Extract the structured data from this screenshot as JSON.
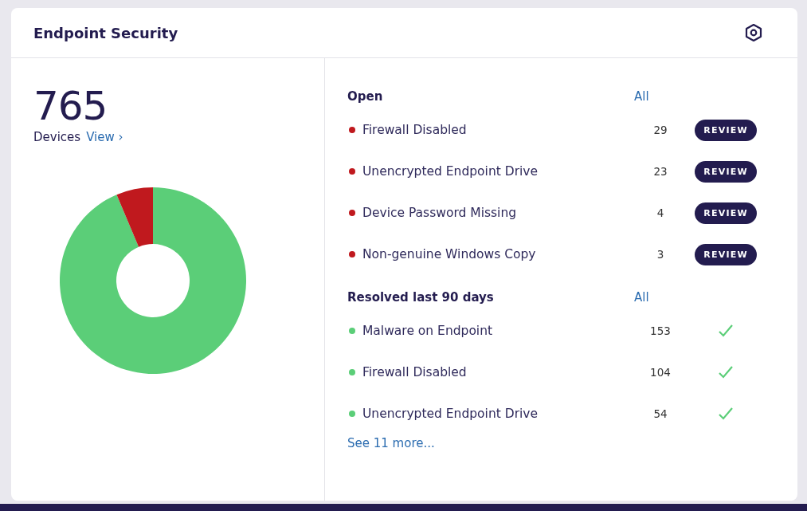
{
  "card": {
    "title": "Endpoint Security"
  },
  "summary": {
    "count": "765",
    "label": "Devices",
    "link": "View ›"
  },
  "sections": [
    {
      "kind": "open",
      "title": "Open",
      "link": "All",
      "items": [
        {
          "label": "Firewall Disabled",
          "count": "29",
          "color": "#c0191e",
          "action": "REVIEW"
        },
        {
          "label": "Unencrypted Endpoint Drive",
          "count": "23",
          "color": "#c0191e",
          "action": "REVIEW"
        },
        {
          "label": "Device Password Missing",
          "count": "4",
          "color": "#c0191e",
          "action": "REVIEW"
        },
        {
          "label": "Non-genuine Windows Copy",
          "count": "3",
          "color": "#c0191e",
          "action": "REVIEW"
        }
      ]
    },
    {
      "kind": "resolved",
      "title": "Resolved last 90 days",
      "link": "All",
      "items": [
        {
          "label": "Malware on Endpoint",
          "count": "153",
          "color": "#5bce78"
        },
        {
          "label": "Firewall Disabled",
          "count": "104",
          "color": "#5bce78"
        },
        {
          "label": "Unencrypted Endpoint Drive",
          "count": "54",
          "color": "#5bce78"
        }
      ]
    }
  ],
  "more_link": "See 11 more..."
}
